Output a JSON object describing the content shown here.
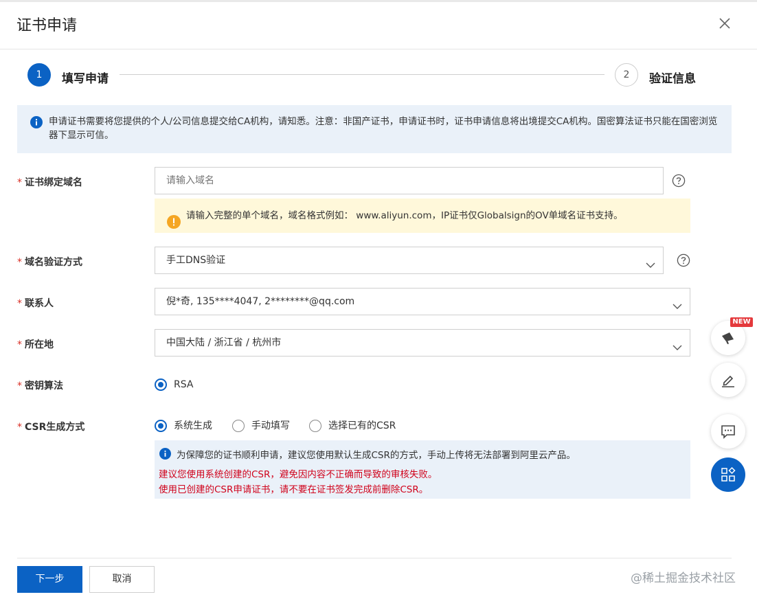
{
  "dialog": {
    "title": "证书申请"
  },
  "steps": [
    {
      "number": "1",
      "label": "填写申请"
    },
    {
      "number": "2",
      "label": "验证信息"
    }
  ],
  "notice": {
    "text": "申请证书需要将您提供的个人/公司信息提交给CA机构，请知悉。注意：非国产证书，申请证书时，证书申请信息将出境提交CA机构。国密算法证书只能在国密浏览器下显示可信。"
  },
  "form": {
    "required_mark": "*",
    "domain": {
      "label": "证书绑定域名",
      "placeholder": "请输入域名",
      "warning": "请输入完整的单个域名，域名格式例如： www.aliyun.com，IP证书仅Globalsign的OV单域名证书支持。"
    },
    "verify_method": {
      "label": "域名验证方式",
      "value": "手工DNS验证"
    },
    "contact": {
      "label": "联系人",
      "value": "倪*奇, 135****4047, 2********@qq.com"
    },
    "location": {
      "label": "所在地",
      "value": "中国大陆 / 浙江省 / 杭州市"
    },
    "algorithm": {
      "label": "密钥算法",
      "options": [
        "RSA"
      ],
      "selected": "RSA"
    },
    "csr": {
      "label": "CSR生成方式",
      "options": [
        "系统生成",
        "手动填写",
        "选择已有的CSR"
      ],
      "selected": "系统生成",
      "note_line1": "为保障您的证书顺利申请，建议您使用默认生成CSR的方式，手动上传将无法部署到阿里云产品。",
      "note_line2": "建议您使用系统创建的CSR，避免因内容不正确而导致的审核失败。",
      "note_line3": "使用已创建的CSR申请证书，请不要在证书签发完成前删除CSR。"
    }
  },
  "footer": {
    "next_label": "下一步",
    "cancel_label": "取消"
  },
  "floating": {
    "new_badge": "NEW"
  },
  "watermark": "@稀土掘金技术社区",
  "colors": {
    "primary": "#0b62c4",
    "required": "#d93026",
    "note_red": "#d0021b",
    "info_bg": "#eaf1f9",
    "warn_bg": "#fff8da"
  },
  "icons": [
    "close-icon",
    "info-icon",
    "help-icon",
    "warning-icon",
    "chevron-down-icon",
    "megaphone-icon",
    "edit-icon",
    "chat-icon",
    "apps-icon"
  ]
}
